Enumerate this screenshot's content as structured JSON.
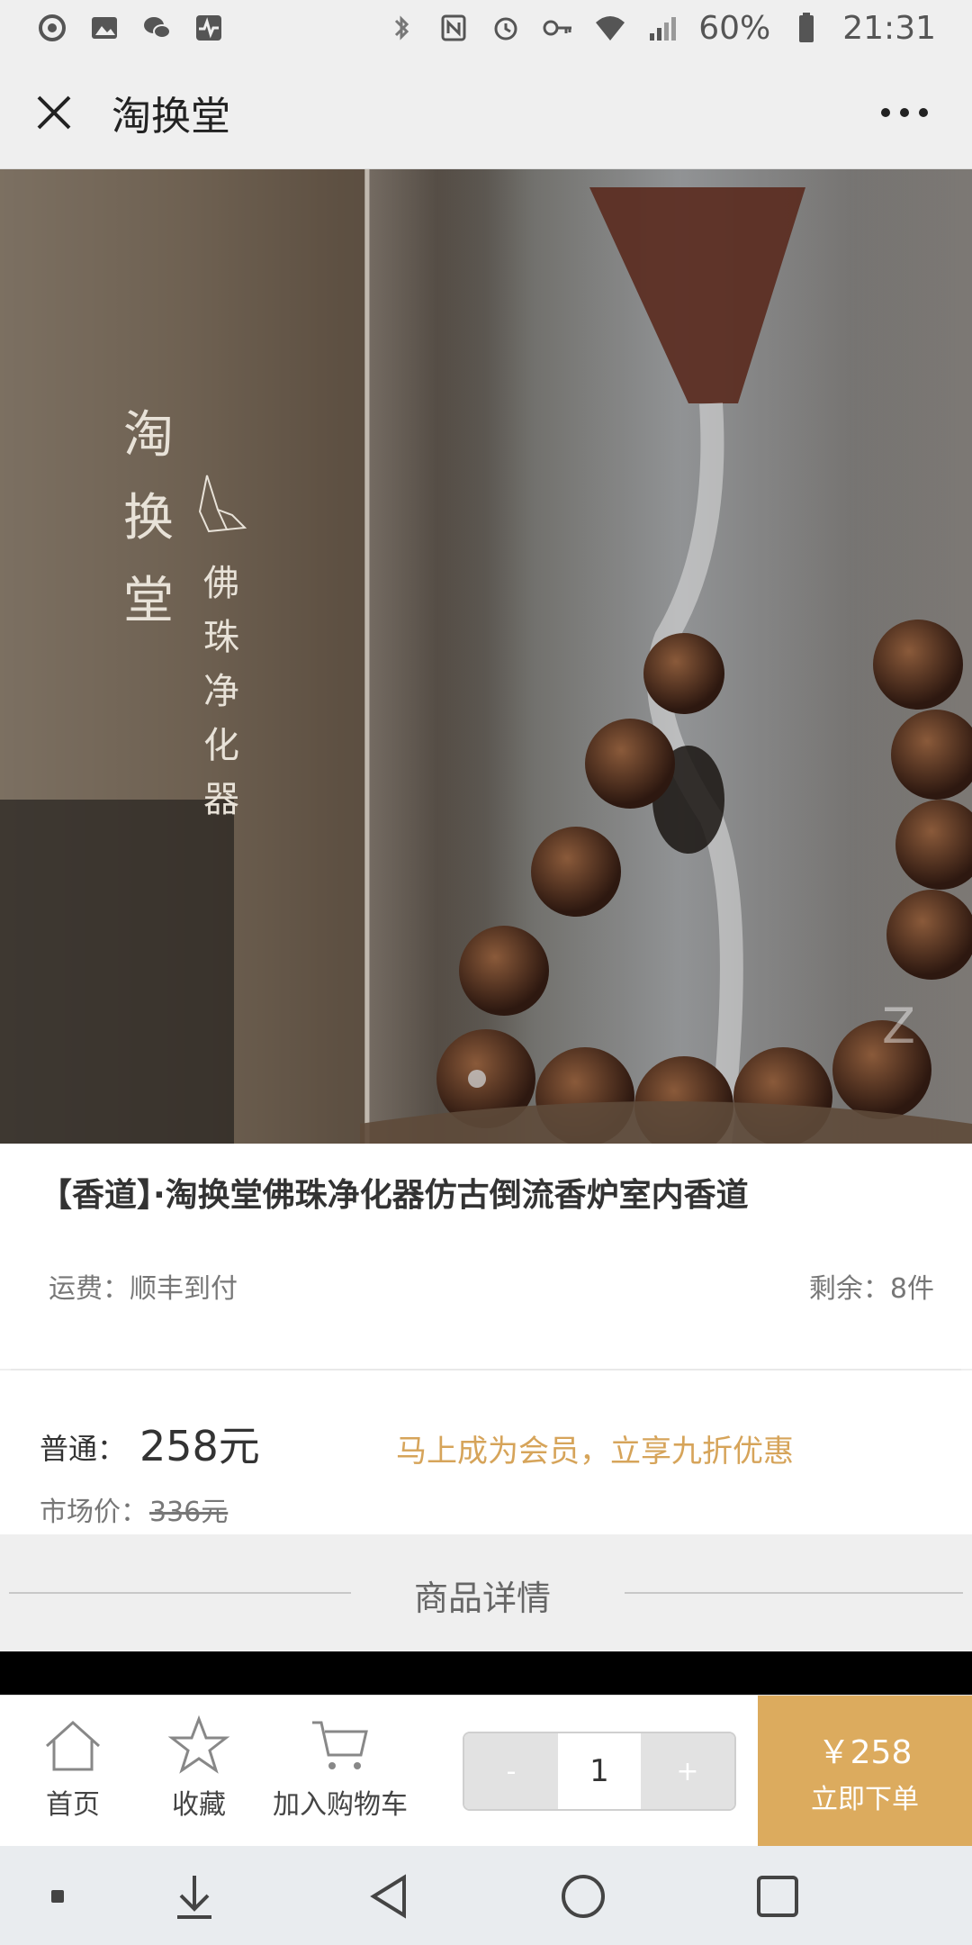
{
  "status_bar": {
    "battery": "60%",
    "time": "21:31"
  },
  "header": {
    "title": "淘换堂"
  },
  "hero": {
    "brand_vertical": "淘换堂",
    "product_vertical": "佛珠净化器",
    "watermark": "Z"
  },
  "product": {
    "title": "【香道】·淘换堂佛珠净化器仿古倒流香炉室内香道",
    "shipping": "运费：顺丰到付",
    "stock": "剩余：8件"
  },
  "price": {
    "label": "普通：",
    "value": "258元",
    "member_promo": "马上成为会员，立享九折优惠",
    "market_label": "市场价：",
    "market_value": "336元"
  },
  "details": {
    "title": "商品详情"
  },
  "action_bar": {
    "home": "首页",
    "favorite": "收藏",
    "add_cart": "加入购物车",
    "minus": "-",
    "quantity": "1",
    "plus": "+",
    "buy_price": "￥258",
    "buy_label": "立即下单"
  },
  "colors": {
    "accent": "#dcab5e",
    "promo_text": "#d6a45a"
  },
  "icons": [
    "netease-icon",
    "gallery-icon",
    "wechat-icon",
    "activity-icon",
    "bluetooth-icon",
    "nfc-icon",
    "alarm-icon",
    "key-icon",
    "wifi-icon",
    "signal-icon",
    "battery-icon",
    "close-icon",
    "more-icon",
    "home-icon",
    "star-icon",
    "cart-icon"
  ]
}
